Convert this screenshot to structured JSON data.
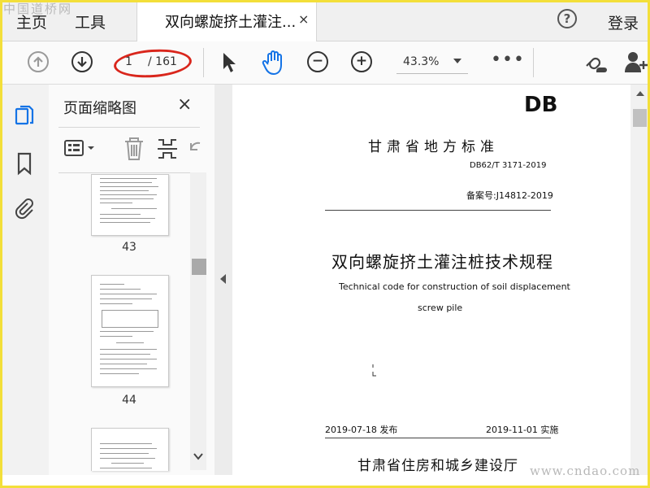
{
  "watermark_top_left": "中国道桥网",
  "watermark_bottom_right": "www.cndao.com",
  "menu": {
    "home": "主页",
    "tools": "工具",
    "login": "登录",
    "help_icon": "?"
  },
  "tab": {
    "title": "双向螺旋挤土灌注...",
    "close": "×"
  },
  "toolbar": {
    "page_current": "1",
    "page_total": "/ 161",
    "zoom": "43.3%",
    "more": "•••",
    "prev_icon": "arrow-up-icon",
    "next_icon": "arrow-down-icon",
    "zoom_out": "−",
    "zoom_in": "+"
  },
  "panel": {
    "title": "页面缩略图",
    "close": "×",
    "thumbnails": [
      {
        "label": "43"
      },
      {
        "label": "44"
      },
      {
        "label": ""
      }
    ]
  },
  "document": {
    "db": "DB",
    "standard": "甘肃省地方标准",
    "code": "DB62/T 3171-2019",
    "record": "备案号:J14812-2019",
    "title_cn": "双向螺旋挤土灌注桩技术规程",
    "title_en_1": "Technical code for construction of soil displacement",
    "title_en_2": "screw pile",
    "release": "2019-07-18 发布",
    "implement": "2019-11-01 实施",
    "issuer": "甘肃省住房和城乡建设厅"
  },
  "colors": {
    "accent": "#1473e6",
    "annotation_oval": "#d9261c",
    "frame": "#f3df3a"
  }
}
